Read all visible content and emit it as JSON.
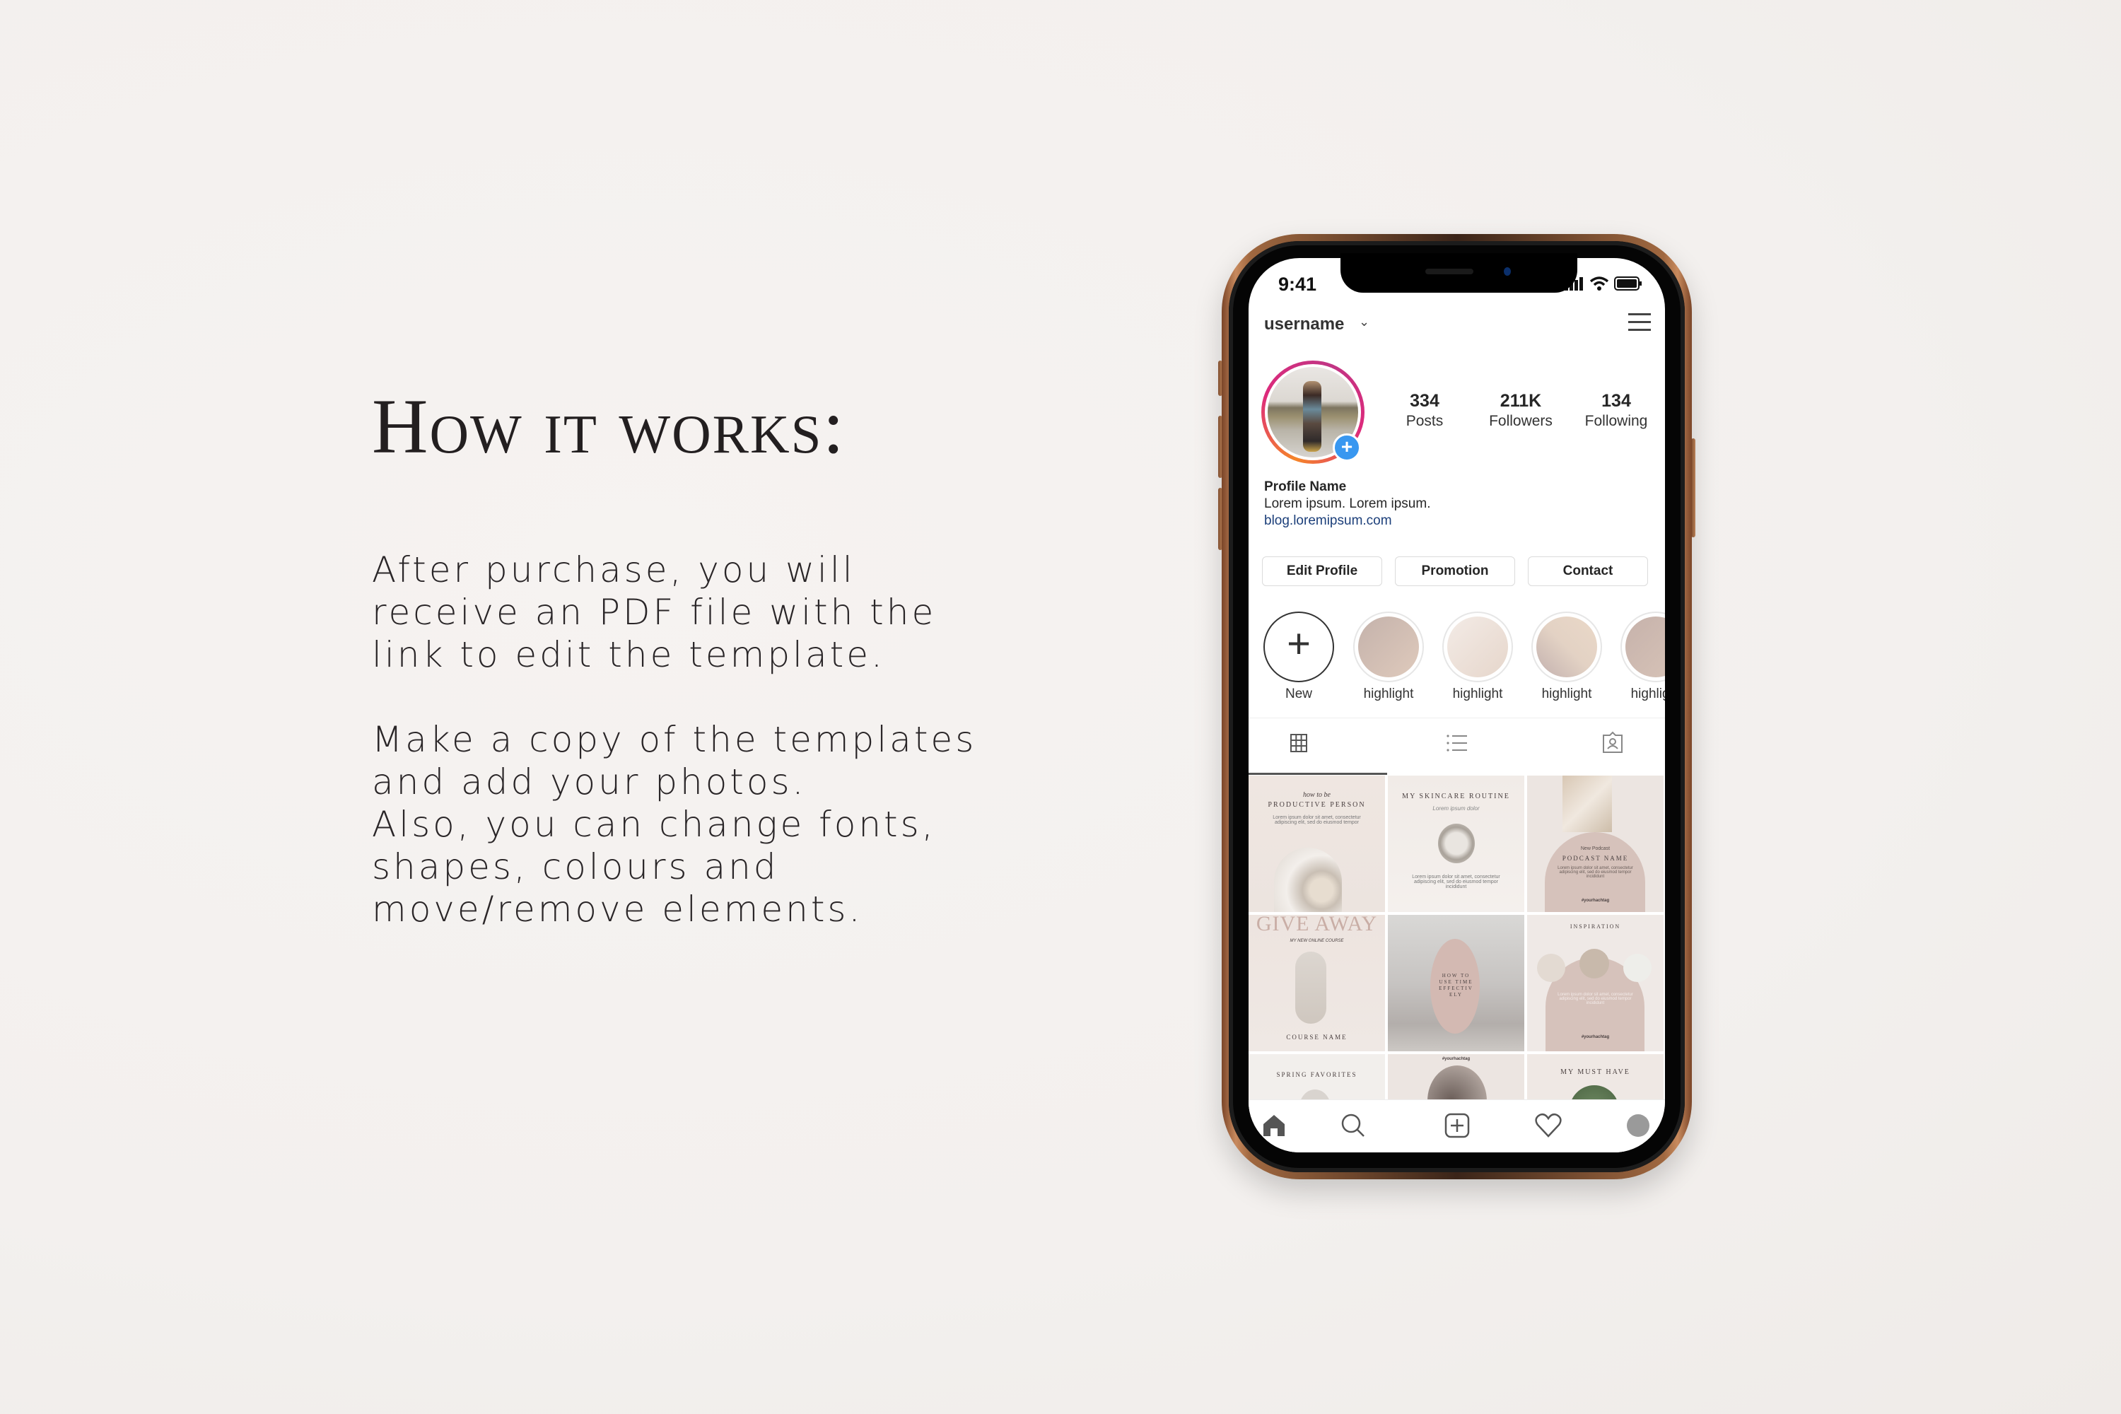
{
  "heading": "How it works:",
  "paragraph1": [
    "After purchase, you will",
    "receive an PDF file with the",
    "link to edit the template."
  ],
  "paragraph2": [
    "Make a copy of the templates",
    "and add your photos.",
    "Also, you can change fonts,",
    "shapes, colours and",
    "move/remove elements."
  ],
  "phone": {
    "status_time": "9:41",
    "status_icons": [
      "signal-icon",
      "wifi-icon",
      "battery-icon"
    ],
    "header": {
      "username": "username",
      "dropdown_icon": "chevron-down-icon",
      "menu_icon": "hamburger-menu-icon"
    },
    "stats": [
      {
        "value": "334",
        "label": "Posts"
      },
      {
        "value": "211K",
        "label": "Followers"
      },
      {
        "value": "134",
        "label": "Following"
      }
    ],
    "bio": {
      "name": "Profile Name",
      "text": "Lorem ipsum. Lorem ipsum.",
      "link": "blog.loremipsum.com"
    },
    "buttons": [
      "Edit Profile",
      "Promotion",
      "Contact"
    ],
    "highlights": [
      {
        "label": "New",
        "icon": "plus-icon"
      },
      {
        "label": "highlight"
      },
      {
        "label": "highlight"
      },
      {
        "label": "highlight"
      },
      {
        "label": "highlight"
      }
    ],
    "tabs": [
      "grid-icon",
      "list-icon",
      "tagged-icon"
    ],
    "posts": [
      {
        "kicker": "how to be",
        "title": "PRODUCTIVE PERSON",
        "body": "Lorem ipsum dolor sit amet, consectetur adipiscing elit, sed do eiusmod tempor"
      },
      {
        "title": "MY SKINCARE ROUTINE",
        "kicker": "Lorem ipsum dolor",
        "body": "Lorem ipsum dolor sit amet, consectetur adipiscing elit, sed do eiusmod tempor incididunt"
      },
      {
        "kicker": "New Podcast",
        "title": "PODCAST NAME",
        "body": "Lorem ipsum dolor sit amet, consectetur adipiscing elit, sed do eiusmod tempor incididunt",
        "tag": "#yourhachtag"
      },
      {
        "headline": "GIVE AWAY",
        "kicker": "MY NEW ONLINE COURSE",
        "title": "COURSE NAME"
      },
      {
        "title": "HOW TO USE TIME EFFECTIV ELY"
      },
      {
        "title": "INSPIRATION",
        "body": "Lorem ipsum dolor sit amet, consectetur adipiscing elit, sed do eiusmod tempor incididunt",
        "tag": "#yourhachtag"
      },
      {
        "title": "SPRING FAVORITES"
      },
      {
        "tag": "#yourhachtag"
      },
      {
        "title": "MY MUST HAVE"
      }
    ],
    "bottom_nav": [
      "home-icon",
      "search-icon",
      "new-post-icon",
      "activity-heart-icon",
      "profile-icon"
    ]
  },
  "colors": {
    "background": "#f3f0ee",
    "text": "#231f20",
    "accent_blue": "#3897f0",
    "link": "#1c3f7a",
    "blush": "#d6c2bb",
    "phone_gold": "#c88a5e"
  }
}
